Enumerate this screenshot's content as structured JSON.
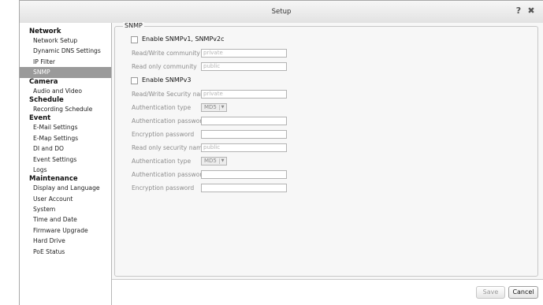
{
  "window": {
    "title": "Setup",
    "help_icon": "?",
    "close_icon": "✖"
  },
  "sidebar": {
    "groups": [
      {
        "label": "Network",
        "items": [
          "Network Setup",
          "Dynamic DNS Settings",
          "IP Filter",
          "SNMP"
        ]
      },
      {
        "label": "Camera",
        "items": [
          "Audio and Video"
        ]
      },
      {
        "label": "Schedule",
        "items": [
          "Recording Schedule"
        ]
      },
      {
        "label": "Event",
        "items": [
          "E-Mail Settings",
          "E-Map Settings",
          "DI and DO",
          "Event Settings",
          "Logs"
        ]
      },
      {
        "label": "Maintenance",
        "items": [
          "Display and Language",
          "User Account",
          "System",
          "Time and Date",
          "Firmware Upgrade",
          "Hard Drive",
          "PoE Status"
        ]
      }
    ],
    "active_item": "SNMP"
  },
  "panel": {
    "legend": "SNMP",
    "v1v2": {
      "checkbox_label": "Enable SNMPv1, SNMPv2c",
      "checked": false,
      "rw_community_label": "Read/Write community",
      "rw_community_value": "private",
      "ro_community_label": "Read only community",
      "ro_community_value": "public"
    },
    "v3": {
      "checkbox_label": "Enable SNMPv3",
      "checked": false,
      "rw_security_name_label": "Read/Write Security name",
      "rw_security_name_value": "private",
      "rw_auth_type_label": "Authentication type",
      "rw_auth_type_value": "MD5",
      "rw_auth_password_label": "Authentication password",
      "rw_encryption_password_label": "Encryption password",
      "ro_security_name_label": "Read only security name",
      "ro_security_name_value": "public",
      "ro_auth_type_label": "Authentication type",
      "ro_auth_type_value": "MD5",
      "ro_auth_password_label": "Authentication password",
      "ro_encryption_password_label": "Encryption password"
    }
  },
  "footer": {
    "save_label": "Save",
    "cancel_label": "Cancel"
  },
  "colors": {
    "active_nav_bg": "#9a9a9a",
    "disabled_text": "#8c8c8c"
  }
}
